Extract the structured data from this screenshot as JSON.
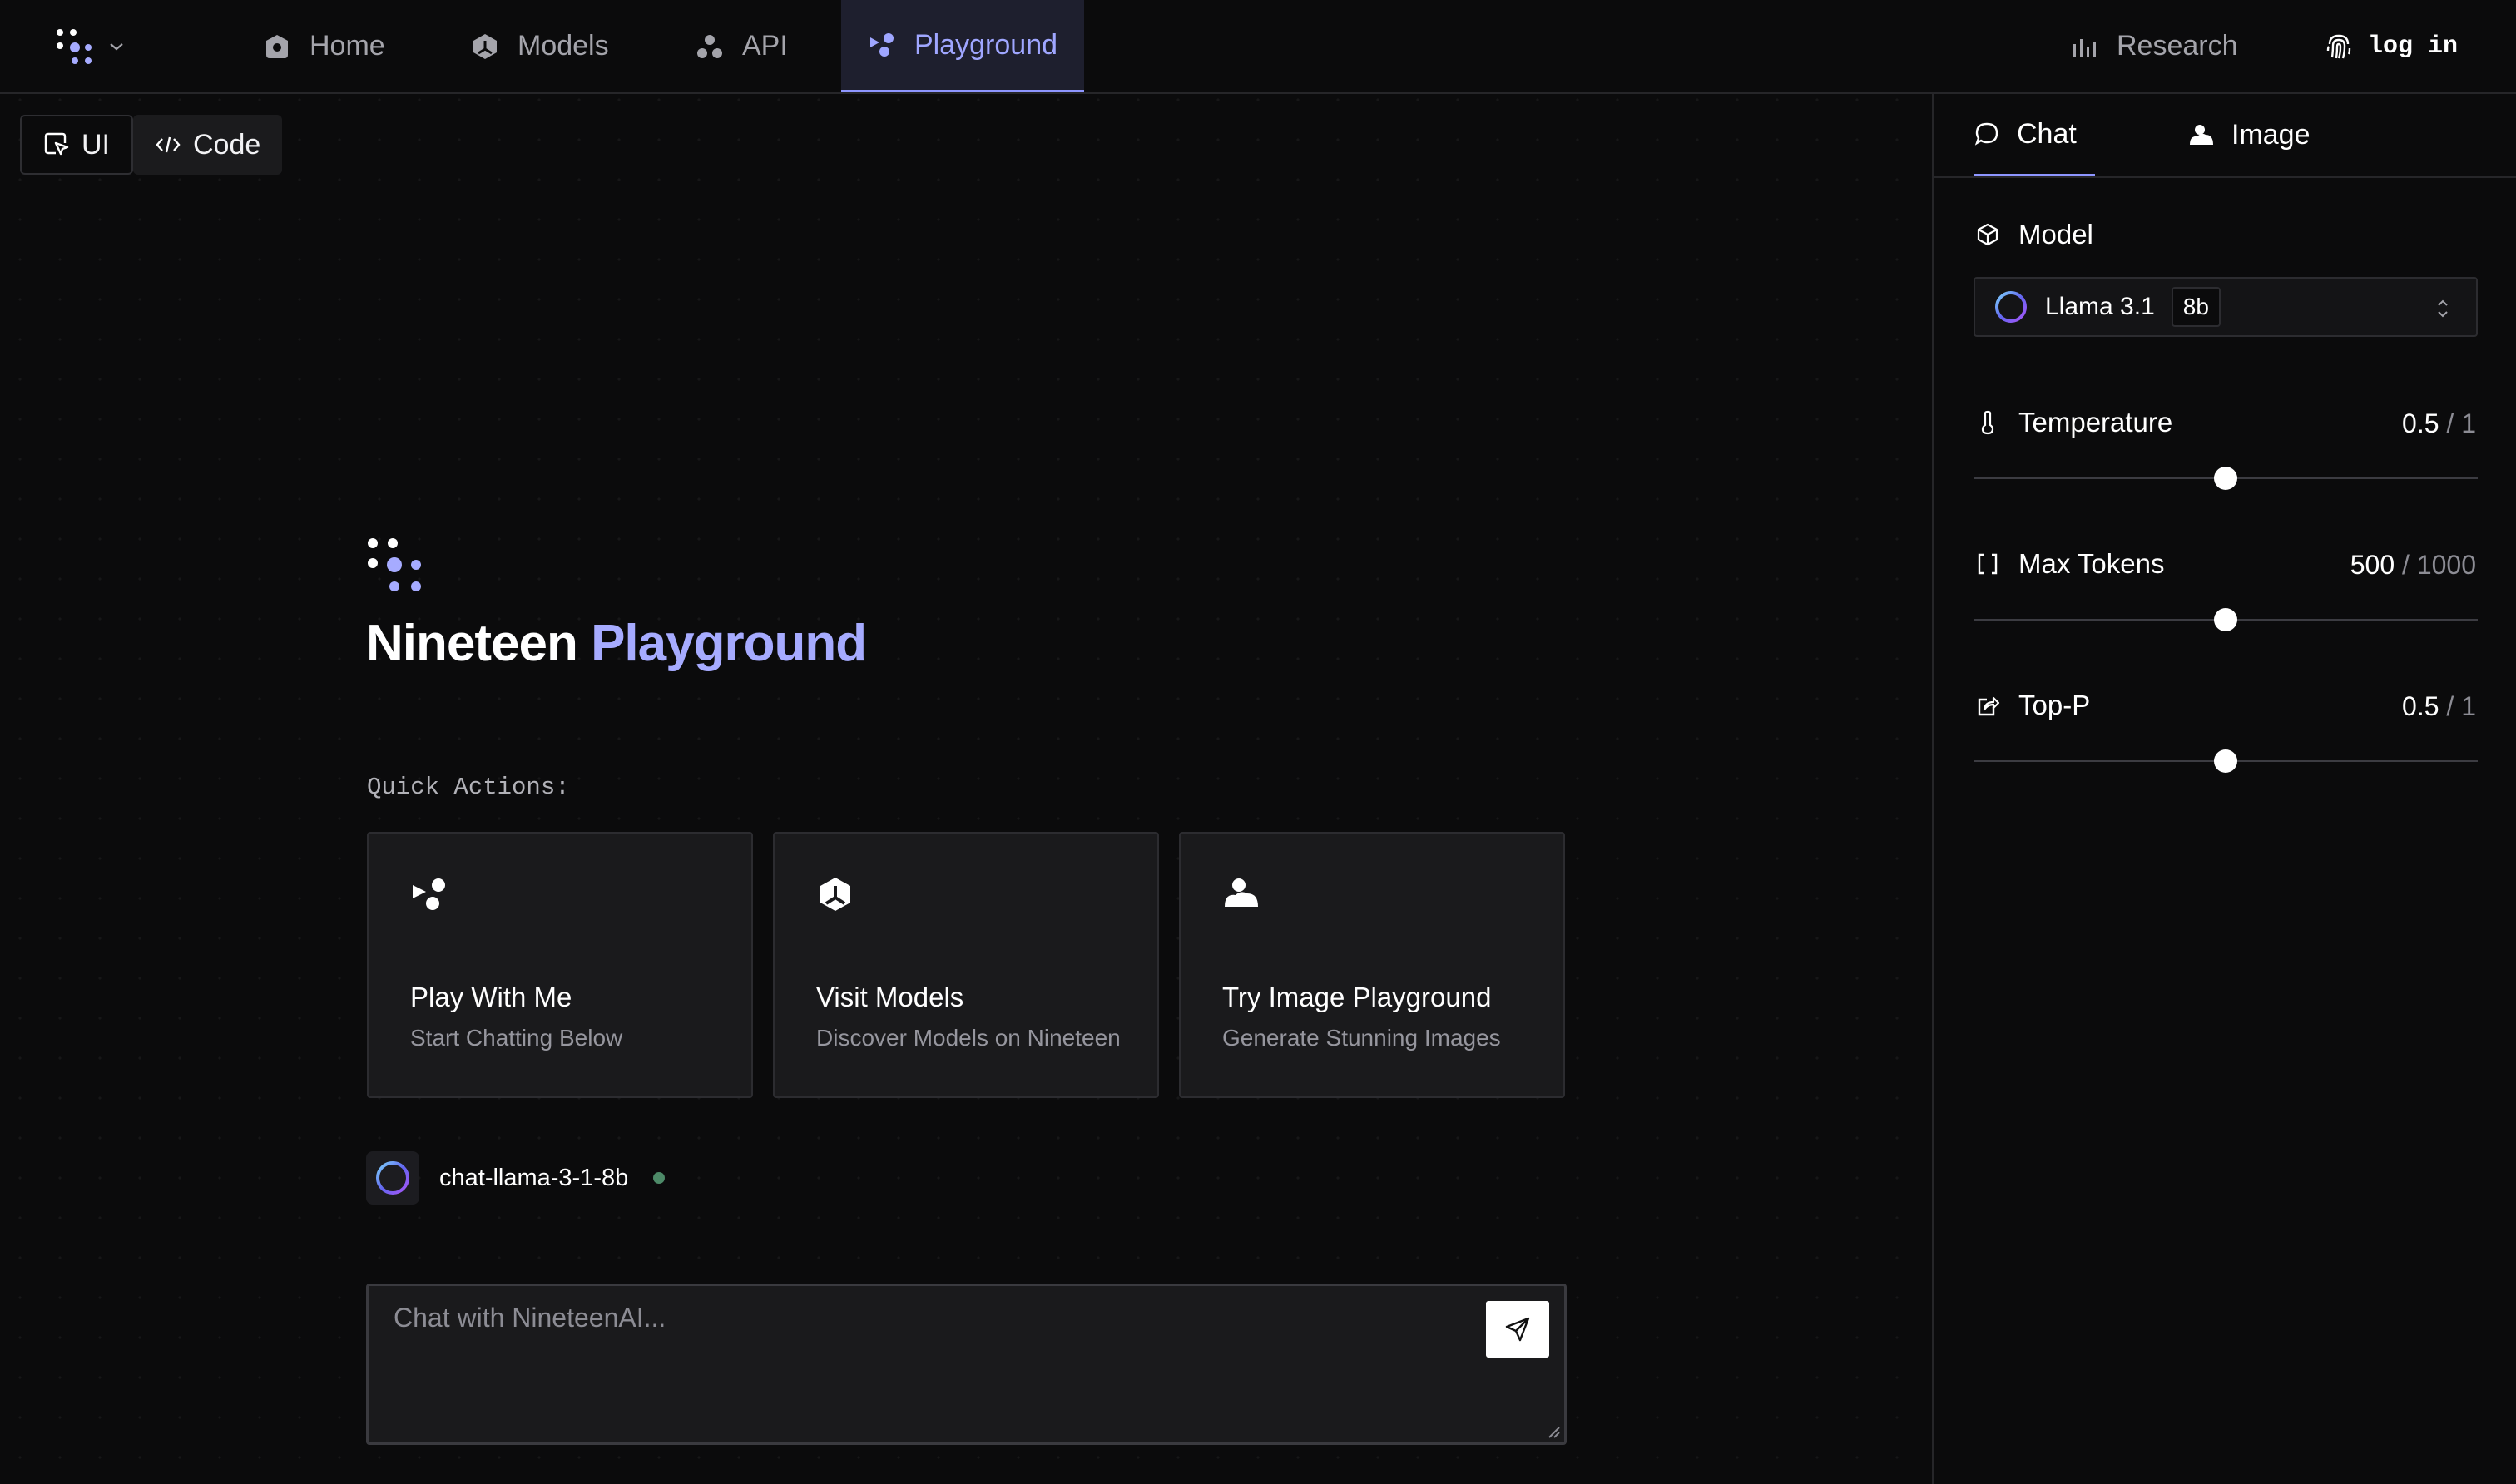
{
  "nav": {
    "home": "Home",
    "models": "Models",
    "api": "API",
    "playground": "Playground",
    "research": "Research",
    "login": "log in"
  },
  "view_toggle": {
    "ui": "UI",
    "code": "Code"
  },
  "hero": {
    "title": "Nineteen",
    "title_accent": "Playground"
  },
  "quick_actions": {
    "label": "Quick Actions:",
    "cards": [
      {
        "title": "Play With Me",
        "subtitle": "Start Chatting Below",
        "icon": "playground-icon"
      },
      {
        "title": "Visit Models",
        "subtitle": "Discover Models on Nineteen",
        "icon": "models-icon"
      },
      {
        "title": "Try Image Playground",
        "subtitle": "Generate Stunning Images",
        "icon": "image-icon"
      }
    ]
  },
  "active_model": {
    "name": "chat-llama-3-1-8b",
    "status_color": "#4d8a68"
  },
  "chat": {
    "placeholder": "Chat with NineteenAI..."
  },
  "panel": {
    "tabs": {
      "chat": "Chat",
      "image": "Image"
    },
    "model": {
      "label": "Model",
      "name": "Llama 3.1",
      "size": "8b"
    },
    "temperature": {
      "label": "Temperature",
      "value": "0.5",
      "max": "1",
      "fraction": 0.5
    },
    "max_tokens": {
      "label": "Max Tokens",
      "value": "500",
      "max": "1000",
      "fraction": 0.5
    },
    "top_p": {
      "label": "Top-P",
      "value": "0.5",
      "max": "1",
      "fraction": 0.5
    }
  },
  "colors": {
    "accent": "#9fa6ff",
    "background": "#0b0b0c",
    "card": "#1a1a1c"
  }
}
